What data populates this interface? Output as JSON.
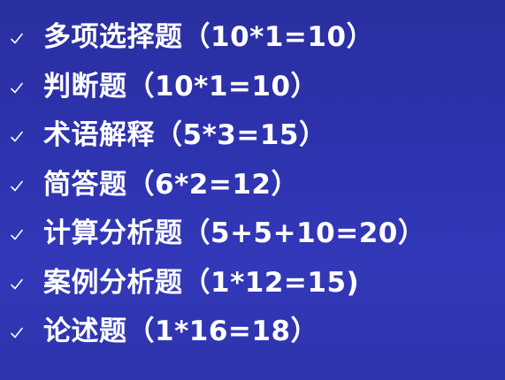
{
  "slide": {
    "items": [
      {
        "icon": "check-icon",
        "text": "多项选择题（10*1=10）"
      },
      {
        "icon": "check-icon",
        "text": "判断题（10*1=10）"
      },
      {
        "icon": "check-icon",
        "text": "术语解释（5*3=15）"
      },
      {
        "icon": "check-icon",
        "text": "简答题（6*2=12）"
      },
      {
        "icon": "check-icon",
        "text": "计算分析题（5+5+10=20）"
      },
      {
        "icon": "check-icon",
        "text": "案例分析题（1*12=15)"
      },
      {
        "icon": "check-icon",
        "text": "论述题（1*16=18）"
      }
    ],
    "colors": {
      "background": "#2d32ad",
      "text": "#ffffff"
    }
  }
}
